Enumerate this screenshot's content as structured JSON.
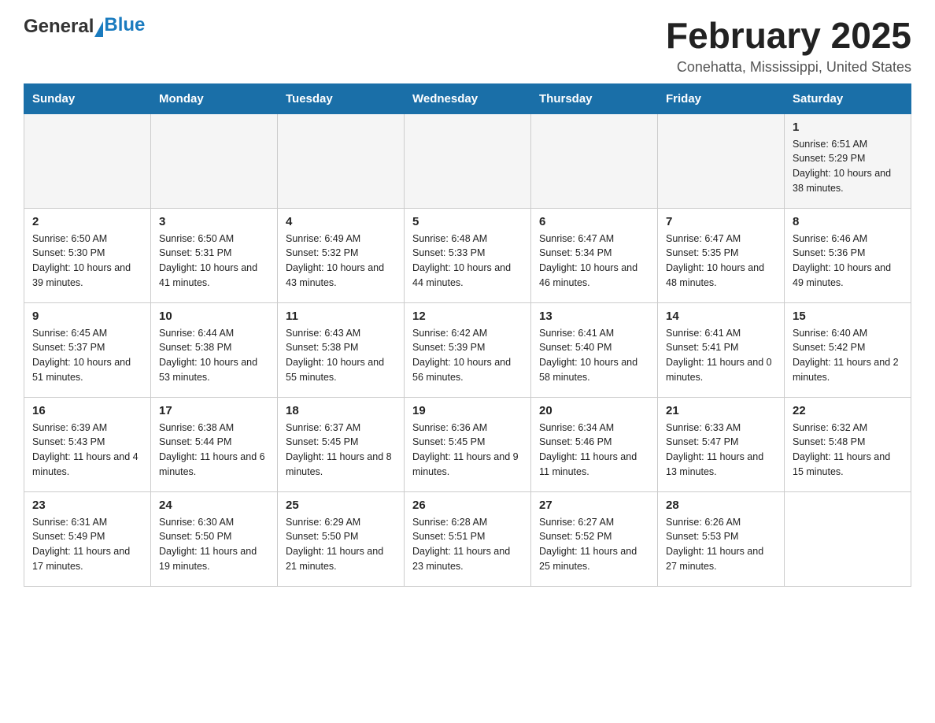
{
  "logo": {
    "general": "General",
    "blue": "Blue"
  },
  "title": "February 2025",
  "location": "Conehatta, Mississippi, United States",
  "days_of_week": [
    "Sunday",
    "Monday",
    "Tuesday",
    "Wednesday",
    "Thursday",
    "Friday",
    "Saturday"
  ],
  "weeks": [
    {
      "id": "week1",
      "cells": [
        {
          "day": "",
          "info": "",
          "empty": true
        },
        {
          "day": "",
          "info": "",
          "empty": true
        },
        {
          "day": "",
          "info": "",
          "empty": true
        },
        {
          "day": "",
          "info": "",
          "empty": true
        },
        {
          "day": "",
          "info": "",
          "empty": true
        },
        {
          "day": "",
          "info": "",
          "empty": true
        },
        {
          "day": "1",
          "info": "Sunrise: 6:51 AM\nSunset: 5:29 PM\nDaylight: 10 hours and 38 minutes.",
          "empty": false
        }
      ]
    },
    {
      "id": "week2",
      "cells": [
        {
          "day": "2",
          "info": "Sunrise: 6:50 AM\nSunset: 5:30 PM\nDaylight: 10 hours and 39 minutes.",
          "empty": false
        },
        {
          "day": "3",
          "info": "Sunrise: 6:50 AM\nSunset: 5:31 PM\nDaylight: 10 hours and 41 minutes.",
          "empty": false
        },
        {
          "day": "4",
          "info": "Sunrise: 6:49 AM\nSunset: 5:32 PM\nDaylight: 10 hours and 43 minutes.",
          "empty": false
        },
        {
          "day": "5",
          "info": "Sunrise: 6:48 AM\nSunset: 5:33 PM\nDaylight: 10 hours and 44 minutes.",
          "empty": false
        },
        {
          "day": "6",
          "info": "Sunrise: 6:47 AM\nSunset: 5:34 PM\nDaylight: 10 hours and 46 minutes.",
          "empty": false
        },
        {
          "day": "7",
          "info": "Sunrise: 6:47 AM\nSunset: 5:35 PM\nDaylight: 10 hours and 48 minutes.",
          "empty": false
        },
        {
          "day": "8",
          "info": "Sunrise: 6:46 AM\nSunset: 5:36 PM\nDaylight: 10 hours and 49 minutes.",
          "empty": false
        }
      ]
    },
    {
      "id": "week3",
      "cells": [
        {
          "day": "9",
          "info": "Sunrise: 6:45 AM\nSunset: 5:37 PM\nDaylight: 10 hours and 51 minutes.",
          "empty": false
        },
        {
          "day": "10",
          "info": "Sunrise: 6:44 AM\nSunset: 5:38 PM\nDaylight: 10 hours and 53 minutes.",
          "empty": false
        },
        {
          "day": "11",
          "info": "Sunrise: 6:43 AM\nSunset: 5:38 PM\nDaylight: 10 hours and 55 minutes.",
          "empty": false
        },
        {
          "day": "12",
          "info": "Sunrise: 6:42 AM\nSunset: 5:39 PM\nDaylight: 10 hours and 56 minutes.",
          "empty": false
        },
        {
          "day": "13",
          "info": "Sunrise: 6:41 AM\nSunset: 5:40 PM\nDaylight: 10 hours and 58 minutes.",
          "empty": false
        },
        {
          "day": "14",
          "info": "Sunrise: 6:41 AM\nSunset: 5:41 PM\nDaylight: 11 hours and 0 minutes.",
          "empty": false
        },
        {
          "day": "15",
          "info": "Sunrise: 6:40 AM\nSunset: 5:42 PM\nDaylight: 11 hours and 2 minutes.",
          "empty": false
        }
      ]
    },
    {
      "id": "week4",
      "cells": [
        {
          "day": "16",
          "info": "Sunrise: 6:39 AM\nSunset: 5:43 PM\nDaylight: 11 hours and 4 minutes.",
          "empty": false
        },
        {
          "day": "17",
          "info": "Sunrise: 6:38 AM\nSunset: 5:44 PM\nDaylight: 11 hours and 6 minutes.",
          "empty": false
        },
        {
          "day": "18",
          "info": "Sunrise: 6:37 AM\nSunset: 5:45 PM\nDaylight: 11 hours and 8 minutes.",
          "empty": false
        },
        {
          "day": "19",
          "info": "Sunrise: 6:36 AM\nSunset: 5:45 PM\nDaylight: 11 hours and 9 minutes.",
          "empty": false
        },
        {
          "day": "20",
          "info": "Sunrise: 6:34 AM\nSunset: 5:46 PM\nDaylight: 11 hours and 11 minutes.",
          "empty": false
        },
        {
          "day": "21",
          "info": "Sunrise: 6:33 AM\nSunset: 5:47 PM\nDaylight: 11 hours and 13 minutes.",
          "empty": false
        },
        {
          "day": "22",
          "info": "Sunrise: 6:32 AM\nSunset: 5:48 PM\nDaylight: 11 hours and 15 minutes.",
          "empty": false
        }
      ]
    },
    {
      "id": "week5",
      "cells": [
        {
          "day": "23",
          "info": "Sunrise: 6:31 AM\nSunset: 5:49 PM\nDaylight: 11 hours and 17 minutes.",
          "empty": false
        },
        {
          "day": "24",
          "info": "Sunrise: 6:30 AM\nSunset: 5:50 PM\nDaylight: 11 hours and 19 minutes.",
          "empty": false
        },
        {
          "day": "25",
          "info": "Sunrise: 6:29 AM\nSunset: 5:50 PM\nDaylight: 11 hours and 21 minutes.",
          "empty": false
        },
        {
          "day": "26",
          "info": "Sunrise: 6:28 AM\nSunset: 5:51 PM\nDaylight: 11 hours and 23 minutes.",
          "empty": false
        },
        {
          "day": "27",
          "info": "Sunrise: 6:27 AM\nSunset: 5:52 PM\nDaylight: 11 hours and 25 minutes.",
          "empty": false
        },
        {
          "day": "28",
          "info": "Sunrise: 6:26 AM\nSunset: 5:53 PM\nDaylight: 11 hours and 27 minutes.",
          "empty": false
        },
        {
          "day": "",
          "info": "",
          "empty": true
        }
      ]
    }
  ]
}
